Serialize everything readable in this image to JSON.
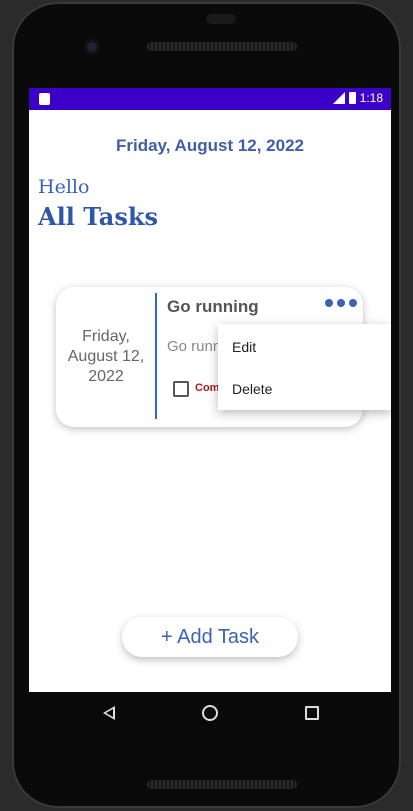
{
  "status_bar": {
    "time": "1:18"
  },
  "header": {
    "date": "Friday, August 12, 2022",
    "greeting": "Hello",
    "title": "All Tasks"
  },
  "task": {
    "date": "Friday,\nAugust 12,\n2022",
    "title": "Go running",
    "description": "Go running",
    "complete_label": "Complete"
  },
  "menu": {
    "edit": "Edit",
    "delete": "Delete"
  },
  "add_button": "+ Add Task",
  "colors": {
    "accent": "#3a63b5",
    "status_bar": "#3d00c8",
    "separator": "#2f6dbe",
    "complete": "#a81a1a"
  }
}
